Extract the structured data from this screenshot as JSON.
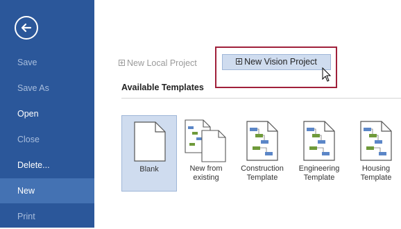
{
  "sidebar": {
    "back_icon": "back-arrow-icon",
    "items": [
      {
        "label": "Save",
        "state": "dim"
      },
      {
        "label": "Save As",
        "state": "dim"
      },
      {
        "label": "Open",
        "state": "bright"
      },
      {
        "label": "Close",
        "state": "dim"
      },
      {
        "label": "Delete...",
        "state": "bright"
      },
      {
        "label": "New",
        "state": "active"
      },
      {
        "label": "Print",
        "state": "dim"
      }
    ],
    "colors": {
      "background": "#2b579a",
      "active": "#4472b3"
    }
  },
  "main": {
    "new_local_project": "New Local Project",
    "new_vision_project": "New Vision Project",
    "available_templates": "Available Templates",
    "templates": [
      {
        "line1": "Blank",
        "line2": "",
        "icon": "blank-document-icon",
        "selected": true
      },
      {
        "line1": "New from",
        "line2": "existing",
        "icon": "copy-documents-icon",
        "selected": false
      },
      {
        "line1": "Construction",
        "line2": "Template",
        "icon": "gantt-template-icon",
        "selected": false
      },
      {
        "line1": "Engineering",
        "line2": "Template",
        "icon": "gantt-template-icon",
        "selected": false
      },
      {
        "line1": "Housing",
        "line2": "Template",
        "icon": "gantt-template-icon",
        "selected": false
      }
    ]
  }
}
